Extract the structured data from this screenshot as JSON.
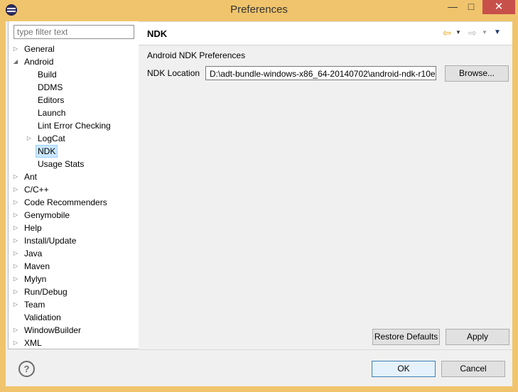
{
  "window": {
    "title": "Preferences",
    "minimize": "—",
    "maximize": "□",
    "close": "✕"
  },
  "filter": {
    "placeholder": "type filter text"
  },
  "tree": [
    {
      "label": "General",
      "depth": 0,
      "arrow": "▷"
    },
    {
      "label": "Android",
      "depth": 0,
      "arrow": "◢"
    },
    {
      "label": "Build",
      "depth": 1,
      "arrow": ""
    },
    {
      "label": "DDMS",
      "depth": 1,
      "arrow": ""
    },
    {
      "label": "Editors",
      "depth": 1,
      "arrow": ""
    },
    {
      "label": "Launch",
      "depth": 1,
      "arrow": ""
    },
    {
      "label": "Lint Error Checking",
      "depth": 1,
      "arrow": ""
    },
    {
      "label": "LogCat",
      "depth": 1,
      "arrow": "▷"
    },
    {
      "label": "NDK",
      "depth": 1,
      "arrow": "",
      "selected": true
    },
    {
      "label": "Usage Stats",
      "depth": 1,
      "arrow": ""
    },
    {
      "label": "Ant",
      "depth": 0,
      "arrow": "▷"
    },
    {
      "label": "C/C++",
      "depth": 0,
      "arrow": "▷"
    },
    {
      "label": "Code Recommenders",
      "depth": 0,
      "arrow": "▷"
    },
    {
      "label": "Genymobile",
      "depth": 0,
      "arrow": "▷"
    },
    {
      "label": "Help",
      "depth": 0,
      "arrow": "▷"
    },
    {
      "label": "Install/Update",
      "depth": 0,
      "arrow": "▷"
    },
    {
      "label": "Java",
      "depth": 0,
      "arrow": "▷"
    },
    {
      "label": "Maven",
      "depth": 0,
      "arrow": "▷"
    },
    {
      "label": "Mylyn",
      "depth": 0,
      "arrow": "▷"
    },
    {
      "label": "Run/Debug",
      "depth": 0,
      "arrow": "▷"
    },
    {
      "label": "Team",
      "depth": 0,
      "arrow": "▷"
    },
    {
      "label": "Validation",
      "depth": 0,
      "arrow": ""
    },
    {
      "label": "WindowBuilder",
      "depth": 0,
      "arrow": "▷"
    },
    {
      "label": "XML",
      "depth": 0,
      "arrow": "▷"
    }
  ],
  "page": {
    "title": "NDK",
    "section_label": "Android NDK Preferences",
    "ndk_location_label": "NDK Location",
    "ndk_location_value": "D:\\adt-bundle-windows-x86_64-20140702\\android-ndk-r10e",
    "browse_label": "Browse...",
    "restore_label": "Restore Defaults",
    "apply_label": "Apply"
  },
  "nav": {
    "back_icon": "⇦",
    "forward_icon": "⇨",
    "dropdown": "▼"
  },
  "footer": {
    "help_icon": "?",
    "ok_label": "OK",
    "cancel_label": "Cancel"
  },
  "colors": {
    "titlebar": "#f0c46c",
    "close": "#c7504b",
    "selection": "#cce8ff",
    "back_arrow": "#e8a000",
    "forward_arrow": "#b5b5b5"
  }
}
